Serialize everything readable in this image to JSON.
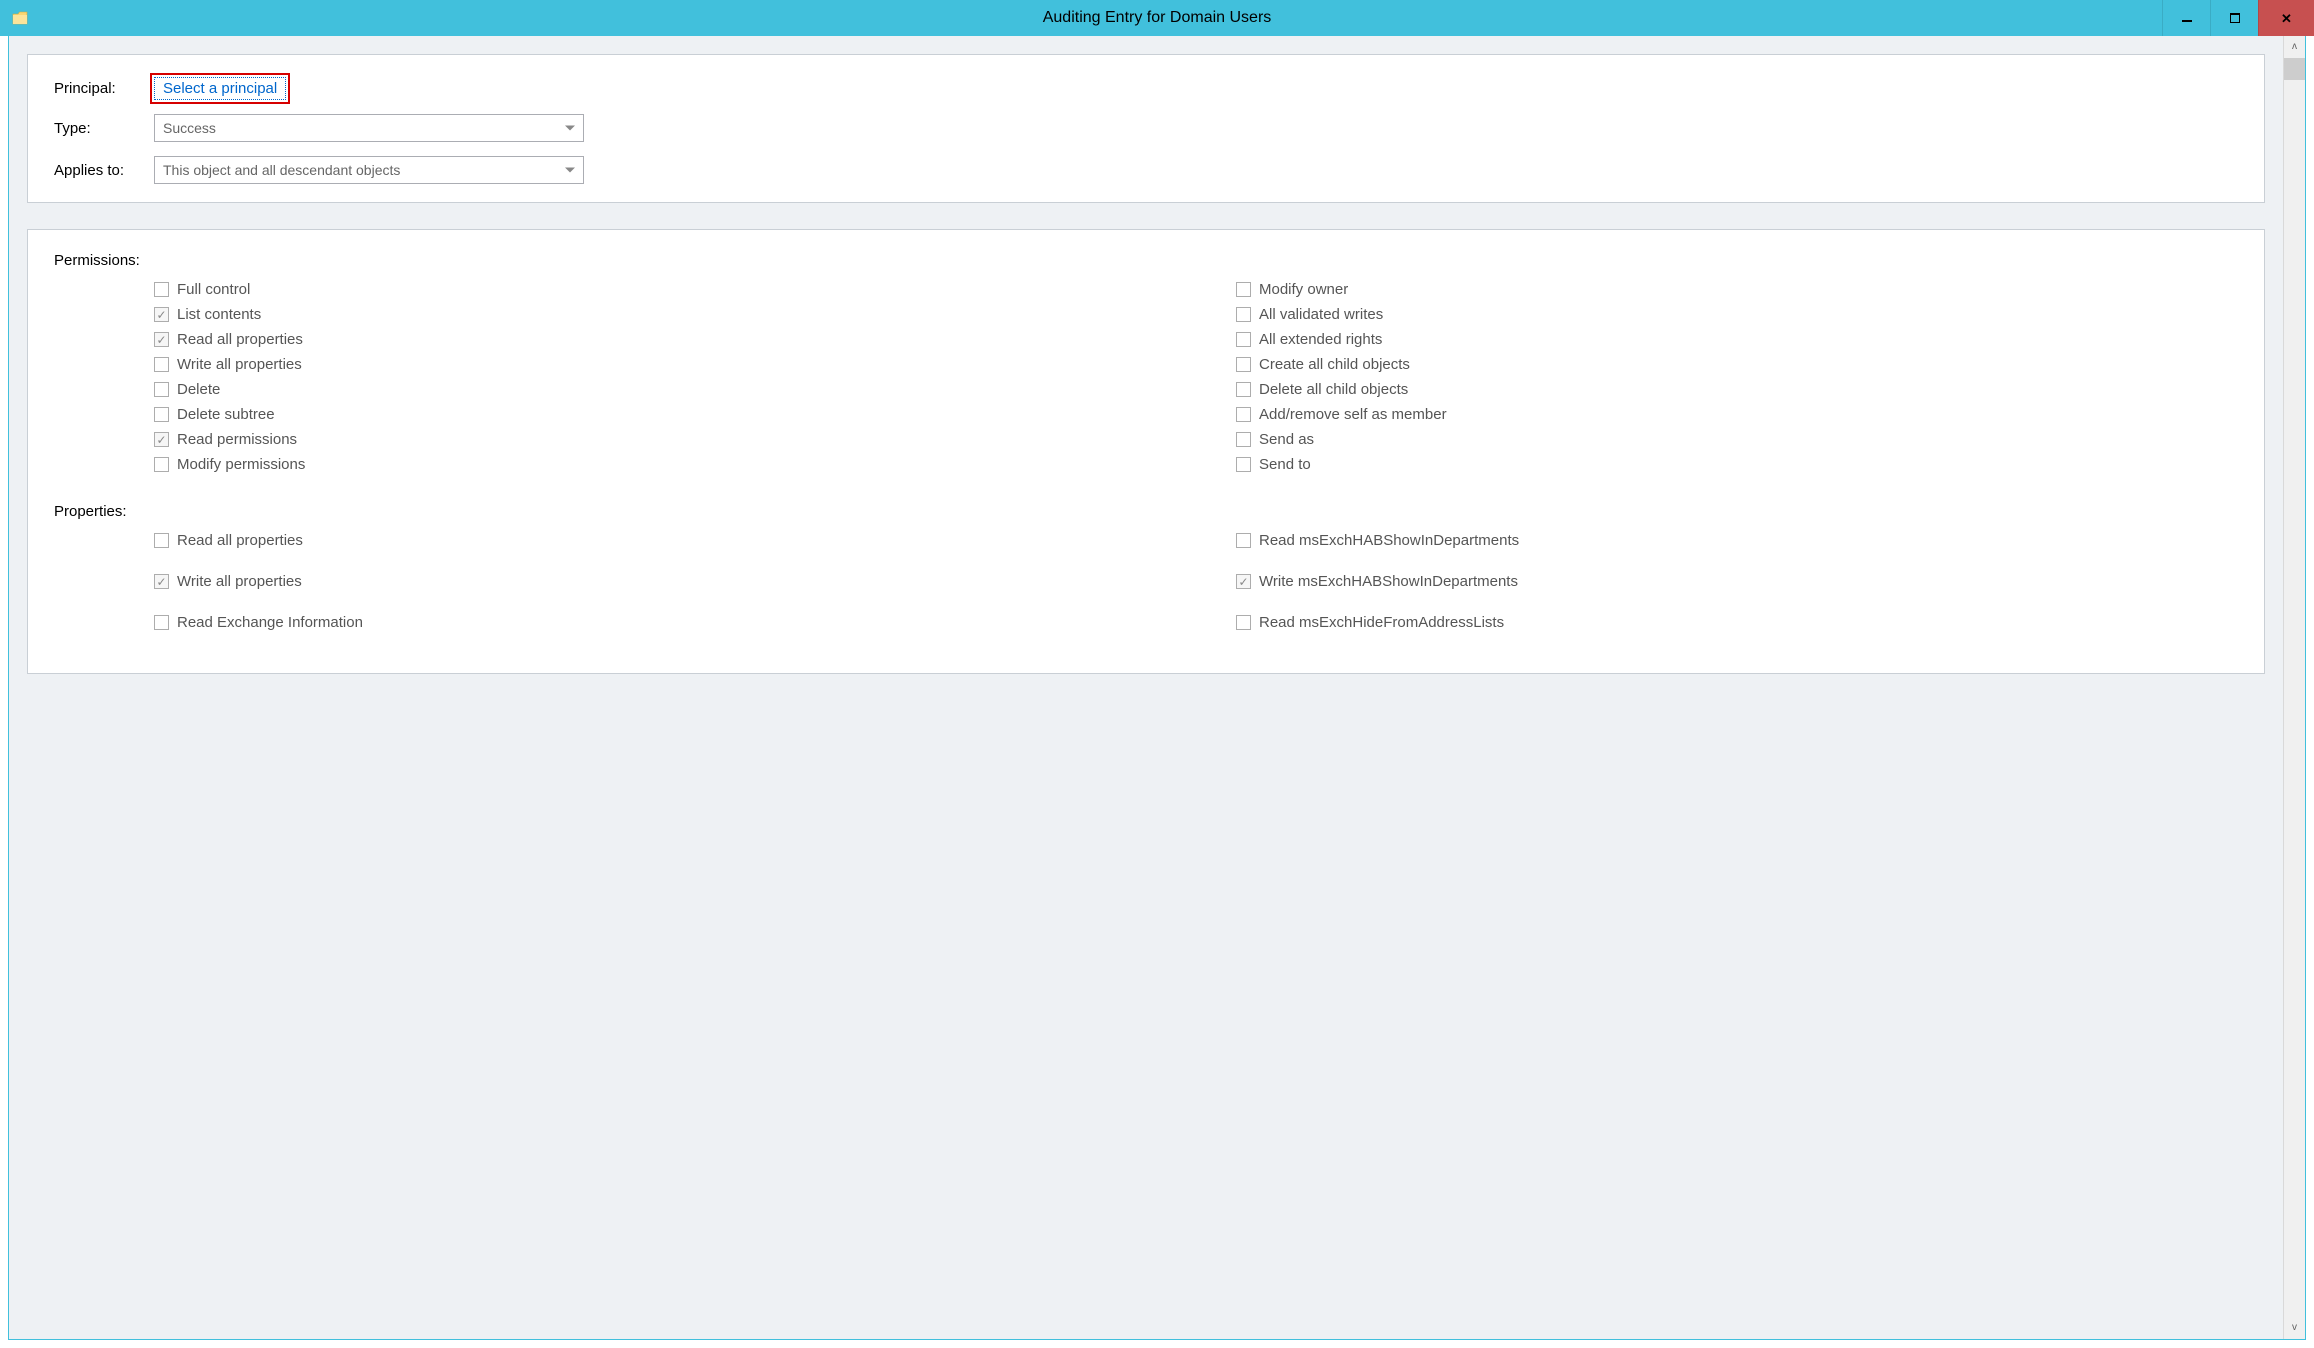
{
  "window": {
    "title": "Auditing Entry for Domain Users"
  },
  "top": {
    "principal_label": "Principal:",
    "principal_link": "Select a principal",
    "type_label": "Type:",
    "type_value": "Success",
    "applies_label": "Applies to:",
    "applies_value": "This object and all descendant objects"
  },
  "permissions": {
    "title": "Permissions:",
    "left": [
      {
        "label": "Full control",
        "checked": false
      },
      {
        "label": "List contents",
        "checked": true
      },
      {
        "label": "Read all properties",
        "checked": true
      },
      {
        "label": "Write all properties",
        "checked": false
      },
      {
        "label": "Delete",
        "checked": false
      },
      {
        "label": "Delete subtree",
        "checked": false
      },
      {
        "label": "Read permissions",
        "checked": true
      },
      {
        "label": "Modify permissions",
        "checked": false
      }
    ],
    "right": [
      {
        "label": "Modify owner",
        "checked": false
      },
      {
        "label": "All validated writes",
        "checked": false
      },
      {
        "label": "All extended rights",
        "checked": false
      },
      {
        "label": "Create all child objects",
        "checked": false
      },
      {
        "label": "Delete all child objects",
        "checked": false
      },
      {
        "label": "Add/remove self as member",
        "checked": false
      },
      {
        "label": "Send as",
        "checked": false
      },
      {
        "label": "Send to",
        "checked": false
      }
    ]
  },
  "properties": {
    "title": "Properties:",
    "left": [
      {
        "label": "Read all properties",
        "checked": false
      },
      {
        "label": "Write all properties",
        "checked": true
      },
      {
        "label": "Read Exchange Information",
        "checked": false
      }
    ],
    "right": [
      {
        "label": "Read msExchHABShowInDepartments",
        "checked": false
      },
      {
        "label": "Write msExchHABShowInDepartments",
        "checked": true
      },
      {
        "label": "Read msExchHideFromAddressLists",
        "checked": false
      }
    ]
  }
}
